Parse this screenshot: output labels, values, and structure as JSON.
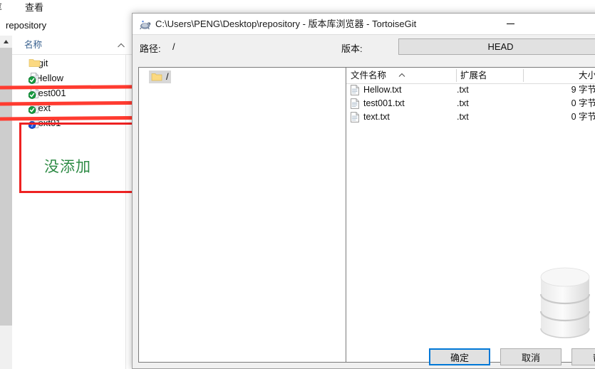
{
  "explorer": {
    "ribbon_tabs": [
      {
        "label": "享",
        "name": "ribbon-tab-share"
      },
      {
        "label": "查看",
        "name": "ribbon-tab-view"
      }
    ],
    "address": "repository",
    "column_header": "名称",
    "files": [
      {
        "name": ".git",
        "icon": "folder-icon",
        "status": "none"
      },
      {
        "name": "Hellow",
        "icon": "text-file-modified-icon",
        "status": "committed"
      },
      {
        "name": "test001",
        "icon": "text-file-modified-icon",
        "status": "committed"
      },
      {
        "name": "text",
        "icon": "text-file-modified-icon",
        "status": "committed"
      },
      {
        "name": "text01",
        "icon": "text-file-unknown-icon",
        "status": "unversioned"
      }
    ]
  },
  "annotation": {
    "label": "没添加",
    "label_color": "#2e8b45",
    "box_color": "#ee2222",
    "arrow_color": "#ff3b30",
    "arrow_count": 3
  },
  "dialog": {
    "title": "C:\\Users\\PENG\\Desktop\\repository - 版本库浏览器 - TortoiseGit",
    "title_icon": "tortoisegit-icon",
    "minimize_label": "—",
    "toolbar": {
      "path_label": "路径:",
      "path_value": "/",
      "revision_label": "版本:",
      "revision_value": "HEAD"
    },
    "tree": {
      "root_label": "/",
      "root_icon": "folder-icon"
    },
    "list": {
      "columns": [
        "文件名称",
        "扩展名",
        "大小"
      ],
      "sort_column": "文件名称",
      "rows": [
        {
          "filename": "Hellow.txt",
          "extension": ".txt",
          "size": "9 字节",
          "icon": "text-file-icon"
        },
        {
          "filename": "test001.txt",
          "extension": ".txt",
          "size": "0 字节",
          "icon": "text-file-icon"
        },
        {
          "filename": "text.txt",
          "extension": ".txt",
          "size": "0 字节",
          "icon": "text-file-icon"
        }
      ]
    },
    "watermark_icon": "database-cylinder-icon",
    "buttons": {
      "ok": "确定",
      "cancel": "取消",
      "help": "帮助"
    }
  }
}
